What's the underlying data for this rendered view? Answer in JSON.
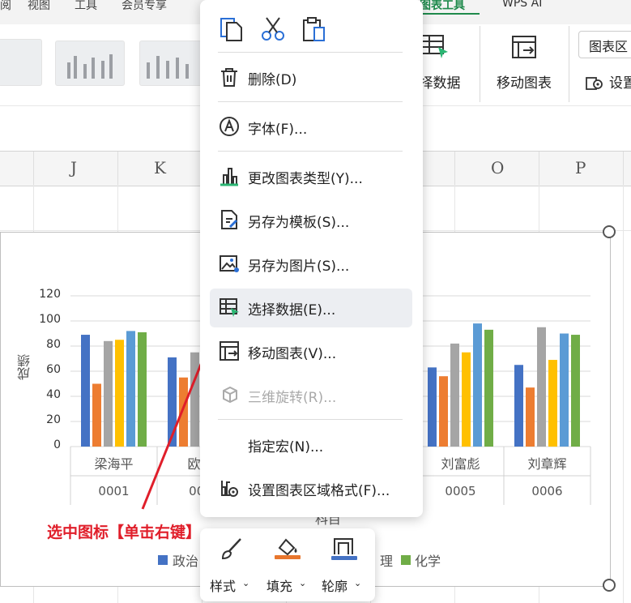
{
  "ribbon": {
    "top_tabs": [
      "阅",
      "视图",
      "工具",
      "会员专享"
    ],
    "active_tab": "图表工具",
    "ai_tab": "WPS AI",
    "select_data_label": "择数据",
    "move_chart_label": "移动图表",
    "chart_area_dropdown": "图表区",
    "settings_label": "设置"
  },
  "columns": [
    "J",
    "K",
    "O",
    "P"
  ],
  "context_menu": {
    "clipboard_icons": [
      "copy-icon",
      "cut-icon",
      "paste-icon"
    ],
    "items": [
      {
        "label": "删除(D)",
        "icon": "trash-icon",
        "enabled": true
      },
      {
        "label": "字体(F)...",
        "icon": "font-icon",
        "enabled": true
      },
      {
        "label": "更改图表类型(Y)...",
        "icon": "chart-type-icon",
        "enabled": true
      },
      {
        "label": "另存为模板(S)...",
        "icon": "save-template-icon",
        "enabled": true
      },
      {
        "label": "另存为图片(S)...",
        "icon": "save-image-icon",
        "enabled": true
      },
      {
        "label": "选择数据(E)...",
        "icon": "select-data-icon",
        "enabled": true,
        "highlighted": true
      },
      {
        "label": "移动图表(V)...",
        "icon": "move-chart-icon",
        "enabled": true
      },
      {
        "label": "三维旋转(R)...",
        "icon": "rotate-3d-icon",
        "enabled": false
      },
      {
        "label": "指定宏(N)...",
        "icon": "",
        "enabled": true
      },
      {
        "label": "设置图表区域格式(F)...",
        "icon": "format-chart-area-icon",
        "enabled": true
      }
    ]
  },
  "mini_toolbar": {
    "style_label": "样式",
    "fill_label": "填充",
    "outline_label": "轮廓",
    "fill_color": "#e8762d",
    "outline_color": "#4472c4"
  },
  "annotation": {
    "text": "选中图标【单击右键】",
    "color": "#e01e2a"
  },
  "chart_data": {
    "type": "bar",
    "ylabel": "成绩",
    "xlabel": "科目",
    "ylim": [
      0,
      120
    ],
    "yticks": [
      "120",
      "100",
      "80",
      "60",
      "40",
      "20",
      "0"
    ],
    "categories": [
      {
        "name": "梁海平",
        "id": "0001"
      },
      {
        "name": "欧海",
        "id": "000"
      },
      {
        "name": "",
        "id": ""
      },
      {
        "name": "",
        "id": ""
      },
      {
        "name": "刘富彪",
        "id": "0005"
      },
      {
        "name": "刘章辉",
        "id": "0006"
      }
    ],
    "series": [
      {
        "name": "政治",
        "color": "#4472c4",
        "values": [
          89,
          71,
          null,
          null,
          63,
          65
        ]
      },
      {
        "name": "",
        "color": "#ed7d31",
        "values": [
          50,
          55,
          null,
          null,
          56,
          47
        ]
      },
      {
        "name": "",
        "color": "#a5a5a5",
        "values": [
          84,
          75,
          null,
          null,
          82,
          95
        ]
      },
      {
        "name": "",
        "color": "#ffc000",
        "values": [
          85,
          null,
          null,
          null,
          75,
          69
        ]
      },
      {
        "name": "理",
        "color": "#5b9bd5",
        "values": [
          92,
          null,
          null,
          null,
          98,
          90
        ]
      },
      {
        "name": "化学",
        "color": "#70ad47",
        "values": [
          91,
          null,
          null,
          null,
          93,
          89
        ]
      }
    ],
    "legend": {
      "position": "bottom",
      "visible_text": [
        "政治",
        "理",
        "化学"
      ]
    },
    "grid": true
  }
}
